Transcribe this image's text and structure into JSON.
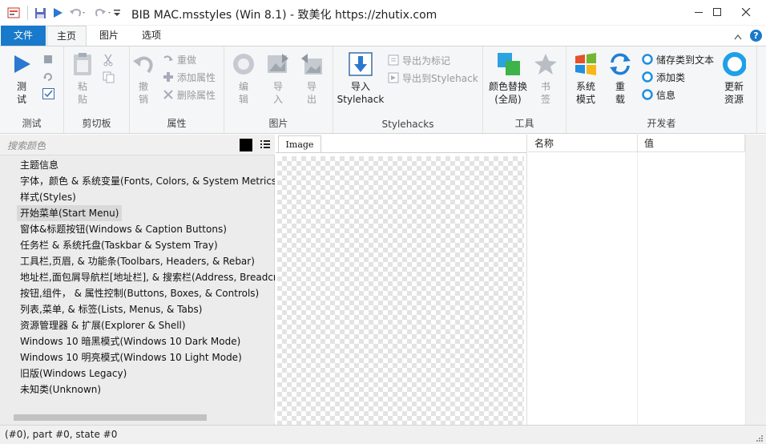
{
  "window": {
    "title": "BIB MAC.msstyles (Win 8.1) - 致美化 https://zhutix.com",
    "controls": [
      "minimize",
      "maximize",
      "close"
    ]
  },
  "ribbon_tabs": {
    "file": "文件",
    "home": "主页",
    "image": "图片",
    "options": "选项"
  },
  "ribbon": {
    "test": {
      "label": "测试",
      "run": "测\n试"
    },
    "clipboard": {
      "label": "剪切板",
      "paste": "粘\n贴"
    },
    "properties": {
      "label": "属性",
      "undo": "撤\n销",
      "redo": "重做",
      "add_prop": "添加属性",
      "del_prop": "删除属性"
    },
    "image": {
      "label": "图片",
      "edit": "编\n辑",
      "import": "导\n入",
      "export": "导\n出"
    },
    "stylehacks": {
      "label": "Stylehacks",
      "import": "导入\nStylehack",
      "export_marker": "导出为标记",
      "export_to": "导出到Stylehack"
    },
    "tools": {
      "label": "工具",
      "color_replace": "颜色替换\n(全局)",
      "bookmark": "书\n签"
    },
    "developer": {
      "label": "开发者",
      "system_mode": "系统\n模式",
      "reload": "重\n载",
      "save_text": "储存类到文本",
      "add_class": "添加类",
      "info": "信息",
      "update": "更新\n资源"
    }
  },
  "search": {
    "placeholder": "搜索颜色"
  },
  "tree": [
    "主题信息",
    "字体，颜色 & 系统变量(Fonts, Colors, & System Metrics)",
    "样式(Styles)",
    "开始菜单(Start Menu)",
    "窗体&标题按钮(Windows & Caption Buttons)",
    "任务栏 & 系统托盘(Taskbar & System Tray)",
    "工具栏,页眉, & 功能条(Toolbars, Headers, & Rebar)",
    "地址栏,面包屑导航栏[地址栏], & 搜索栏(Address, Breadcrumb, & Search)",
    "按钮,组件， & 属性控制(Buttons, Boxes, & Controls)",
    "列表,菜单, & 标签(Lists, Menus, & Tabs)",
    "资源管理器 & 扩展(Explorer & Shell)",
    "Windows 10 暗黑模式(Windows 10 Dark Mode)",
    "Windows 10 明亮模式(Windows 10 Light Mode)",
    "旧版(Windows Legacy)",
    "未知类(Unknown)"
  ],
  "tree_selected_index": 3,
  "image_panel": {
    "tab": "Image"
  },
  "property_grid": {
    "col_name": "名称",
    "col_value": "值"
  },
  "status": {
    "text": "(#0),  part #0,  state #0"
  },
  "colors": {
    "accent": "#1979ca",
    "ribbon_bg": "#f5f6f7",
    "pane_bg": "#ececec",
    "selection": "#d9d9d9"
  }
}
